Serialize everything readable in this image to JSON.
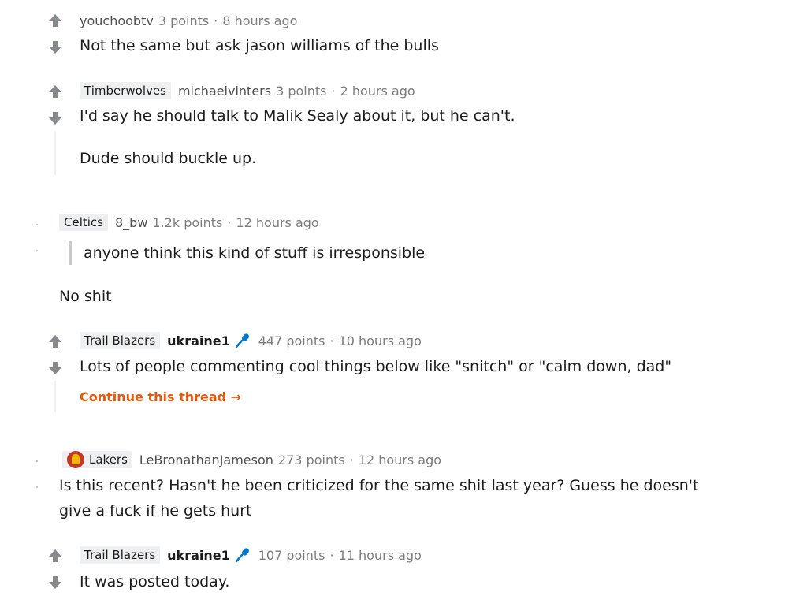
{
  "comments": [
    {
      "flair": "",
      "user": "youchoobtv",
      "points": "3 points",
      "sep": "·",
      "time": "8 hours ago",
      "body": [
        "Not the same but ask jason williams of the bulls"
      ]
    },
    {
      "flair": "Timberwolves",
      "user": "michaelvinters",
      "points": "3 points",
      "sep": "·",
      "time": "2 hours ago",
      "body": [
        "I'd say he should talk to Malik Sealy about it, but he can't.",
        "Dude should buckle up."
      ]
    },
    {
      "flair": "Celtics",
      "user": "8_bw",
      "points": "1.2k points",
      "sep": "·",
      "time": "12 hours ago",
      "quote": "anyone think this kind of stuff is irresponsible",
      "body": [
        "No shit"
      ]
    },
    {
      "flair": "Trail Blazers",
      "user": "ukraine1",
      "user_icon": "microphone-icon",
      "points": "447 points",
      "sep": "·",
      "time": "10 hours ago",
      "body": [
        "Lots of people commenting cool things below like \"snitch\" or \"calm down, dad\""
      ],
      "continue_link": "Continue this thread →"
    },
    {
      "flair": "Lakers",
      "flair_icon": "lakers-logo-icon",
      "user": "LeBronathanJameson",
      "points": "273 points",
      "sep": "·",
      "time": "12 hours ago",
      "body": [
        "Is this recent? Hasn't he been criticized for the same shit last year? Guess he doesn't",
        "give a fuck if he gets hurt"
      ]
    },
    {
      "flair": "Trail Blazers",
      "user": "ukraine1",
      "user_icon": "microphone-icon",
      "points": "107 points",
      "sep": "·",
      "time": "11 hours ago",
      "body": [
        "It was posted today."
      ]
    }
  ],
  "colors": {
    "text": "#1c1c1c",
    "meta": "#7c7c7c",
    "flair_bg": "#edeff1",
    "vote_arrow": "#878a8c",
    "link": "#e8590c",
    "mic": "#0079d3"
  }
}
